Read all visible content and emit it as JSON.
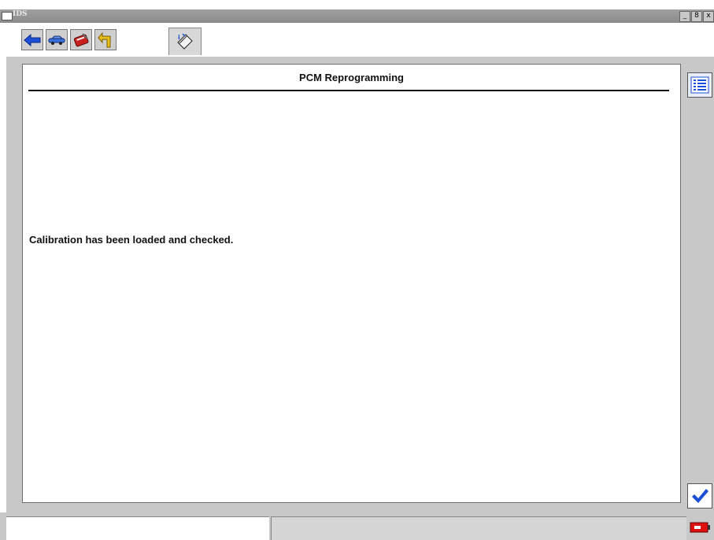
{
  "window": {
    "title": "IDS",
    "controls": [
      "_",
      "8",
      "x"
    ]
  },
  "toolbar": {
    "buttons": [
      {
        "name": "back",
        "icon": "back-arrow-icon"
      },
      {
        "name": "vehicle",
        "icon": "vehicle-icon"
      },
      {
        "name": "toolbox",
        "icon": "toolbox-icon"
      },
      {
        "name": "turn",
        "icon": "turn-arrow-icon"
      },
      {
        "name": "info",
        "icon": "info-book-icon"
      }
    ]
  },
  "panel": {
    "title": "PCM Reprogramming",
    "message": "Calibration has been loaded and checked."
  },
  "side": {
    "list_icon": "list-icon",
    "confirm_icon": "checkmark-icon"
  },
  "status": {
    "left_text": "",
    "mid_text": ""
  },
  "colors": {
    "accent_blue": "#1c4fd6",
    "battery_red": "#e01010",
    "frame_gray": "#c8c8c8"
  }
}
